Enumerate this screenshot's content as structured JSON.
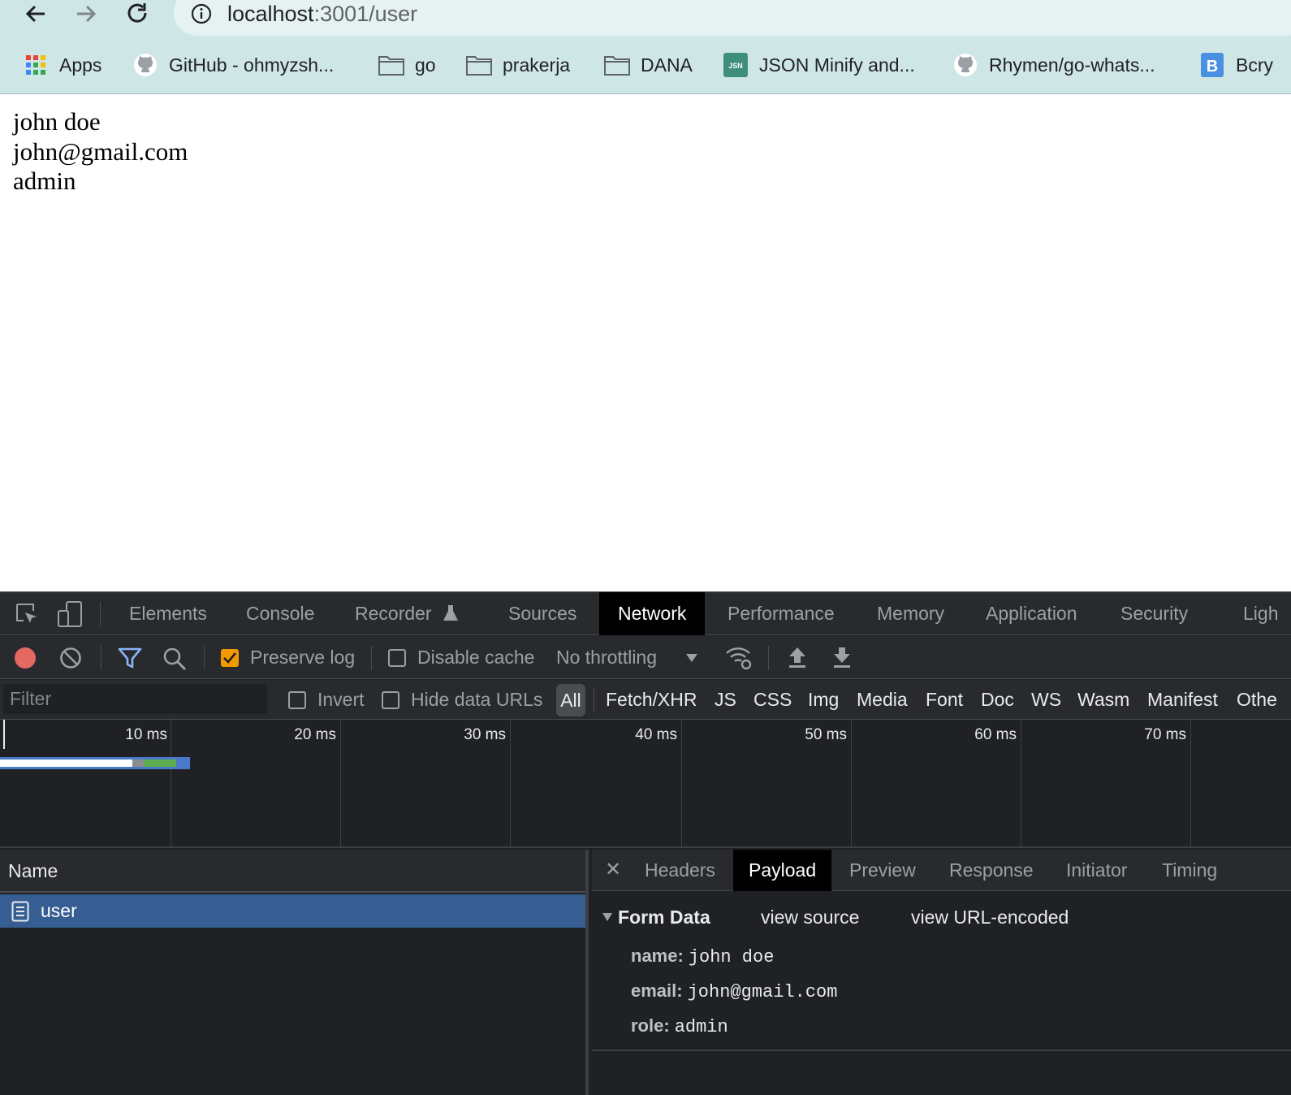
{
  "browser": {
    "url_host": "localhost",
    "url_path": ":3001/user",
    "bookmarks": [
      {
        "label": "Apps",
        "icon": "apps-grid-icon"
      },
      {
        "label": "GitHub - ohmyzsh...",
        "icon": "github-icon"
      },
      {
        "label": "go",
        "icon": "folder-icon"
      },
      {
        "label": "prakerja",
        "icon": "folder-icon"
      },
      {
        "label": "DANA",
        "icon": "folder-icon"
      },
      {
        "label": "JSON Minify and...",
        "icon": "json-icon"
      },
      {
        "label": "Rhymen/go-whats...",
        "icon": "github-icon"
      },
      {
        "label": "Bcry",
        "icon": "bcrypt-icon"
      }
    ]
  },
  "page": {
    "lines": [
      "john doe",
      "john@gmail.com",
      "admin"
    ]
  },
  "devtools": {
    "tabs": [
      "Elements",
      "Console",
      "Recorder",
      "Sources",
      "Network",
      "Performance",
      "Memory",
      "Application",
      "Security",
      "Ligh"
    ],
    "active_tab": "Network",
    "toolbar": {
      "preserve_log": "Preserve log",
      "preserve_log_checked": true,
      "disable_cache": "Disable cache",
      "disable_cache_checked": false,
      "throttling": "No throttling"
    },
    "filter": {
      "placeholder": "Filter",
      "invert": "Invert",
      "hide_data_urls": "Hide data URLs",
      "types": [
        "All",
        "Fetch/XHR",
        "JS",
        "CSS",
        "Img",
        "Media",
        "Font",
        "Doc",
        "WS",
        "Wasm",
        "Manifest",
        "Othe"
      ],
      "active_type": "All"
    },
    "timeline": {
      "ticks": [
        "10 ms",
        "20 ms",
        "30 ms",
        "40 ms",
        "50 ms",
        "60 ms",
        "70 ms"
      ]
    },
    "requests": {
      "column_name": "Name",
      "rows": [
        "user"
      ]
    },
    "details": {
      "tabs": [
        "Headers",
        "Payload",
        "Preview",
        "Response",
        "Initiator",
        "Timing"
      ],
      "active_tab": "Payload",
      "form_data_title": "Form Data",
      "view_source": "view source",
      "view_url_encoded": "view URL-encoded",
      "fields": [
        {
          "key": "name:",
          "value": "john doe"
        },
        {
          "key": "email:",
          "value": "john@gmail.com"
        },
        {
          "key": "role:",
          "value": "admin"
        }
      ]
    }
  },
  "colors": {
    "chrome_bg": "#cfe6e6",
    "devtools_bg": "#202124",
    "selected_row": "#365e93",
    "record": "#e46962",
    "checkbox_checked": "#f29900",
    "filter_icon": "#8ab4f8"
  }
}
